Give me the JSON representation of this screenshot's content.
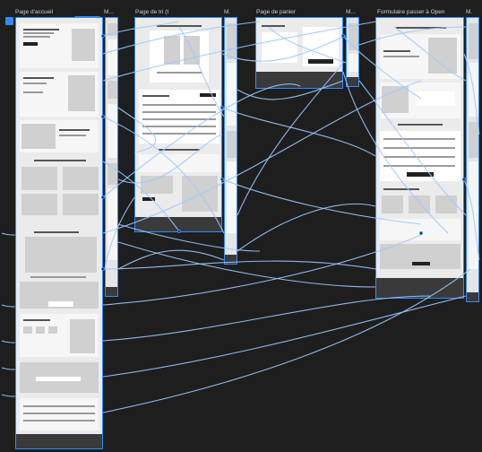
{
  "canvas": {
    "background": "#1e1e1e",
    "accent": "#2f8cff"
  },
  "frames": [
    {
      "label": "Page d'accueil"
    },
    {
      "label": "M..."
    },
    {
      "label": "Page de tri (t"
    },
    {
      "label": "M."
    },
    {
      "label": "Page de panier"
    },
    {
      "label": "M..."
    },
    {
      "label": "Formulaire passer à Open"
    },
    {
      "label": "M."
    }
  ],
  "selection_badge": {
    "icon": "frame-icon"
  },
  "flow_button": {
    "label": "▸"
  }
}
